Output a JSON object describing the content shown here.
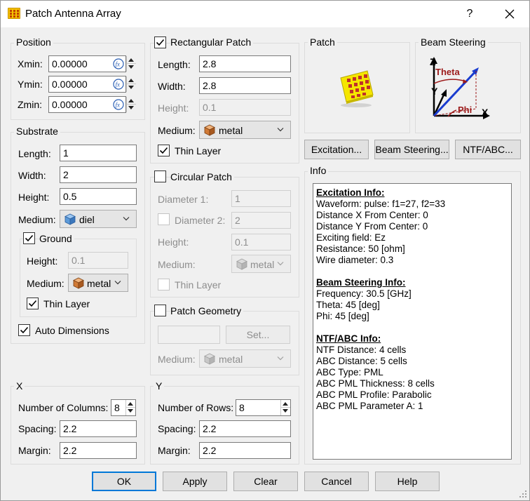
{
  "window": {
    "title": "Patch Antenna Array",
    "help": "?"
  },
  "position": {
    "title": "Position",
    "xmin": {
      "label": "Xmin:",
      "value": "0.00000"
    },
    "ymin": {
      "label": "Ymin:",
      "value": "0.00000"
    },
    "zmin": {
      "label": "Zmin:",
      "value": "0.00000"
    }
  },
  "substrate": {
    "title": "Substrate",
    "length": {
      "label": "Length:",
      "value": "1"
    },
    "width": {
      "label": "Width:",
      "value": "2"
    },
    "height": {
      "label": "Height:",
      "value": "0.5"
    },
    "medium": {
      "label": "Medium:",
      "value": "diel"
    },
    "ground": {
      "label": "Ground",
      "checked": true,
      "height": {
        "label": "Height:",
        "value": "0.1"
      },
      "medium": {
        "label": "Medium:",
        "value": "metal"
      },
      "thin_layer": {
        "label": "Thin Layer",
        "checked": true
      }
    },
    "auto_dimensions": {
      "label": "Auto Dimensions",
      "checked": true
    }
  },
  "rect_patch": {
    "label": "Rectangular Patch",
    "checked": true,
    "length": {
      "label": "Length:",
      "value": "2.8"
    },
    "width": {
      "label": "Width:",
      "value": "2.8"
    },
    "height": {
      "label": "Height:",
      "value": "0.1"
    },
    "medium": {
      "label": "Medium:",
      "value": "metal"
    },
    "thin_layer": {
      "label": "Thin Layer",
      "checked": true
    }
  },
  "circ_patch": {
    "label": "Circular Patch",
    "checked": false,
    "diameter1": {
      "label": "Diameter 1:",
      "value": "1"
    },
    "diameter2": {
      "label": "Diameter 2:",
      "value": "2"
    },
    "height": {
      "label": "Height:",
      "value": "0.1"
    },
    "medium": {
      "label": "Medium:",
      "value": "metal"
    },
    "thin_layer": {
      "label": "Thin Layer"
    }
  },
  "patch_geometry": {
    "label": "Patch Geometry",
    "checked": false,
    "set_label": "Set...",
    "medium": {
      "label": "Medium:",
      "value": "metal"
    }
  },
  "x": {
    "title": "X",
    "count": {
      "label": "Number of Columns:",
      "value": "8"
    },
    "spacing": {
      "label": "Spacing:",
      "value": "2.2"
    },
    "margin": {
      "label": "Margin:",
      "value": "2.2"
    }
  },
  "y": {
    "title": "Y",
    "count": {
      "label": "Number of Rows:",
      "value": "8"
    },
    "spacing": {
      "label": "Spacing:",
      "value": "2.2"
    },
    "margin": {
      "label": "Margin:",
      "value": "2.2"
    }
  },
  "patch_preview": {
    "title": "Patch"
  },
  "beam_preview": {
    "title": "Beam Steering",
    "axis_z": "Z",
    "axis_y": "Y",
    "axis_x": "X",
    "theta": "Theta",
    "phi": "Phi"
  },
  "action_buttons": {
    "excitation": "Excitation...",
    "beam_steering": "Beam Steering...",
    "ntf_abc": "NTF/ABC..."
  },
  "info": {
    "title": "Info",
    "excitation": {
      "heading": "Excitation Info:",
      "lines": [
        "Waveform: pulse: f1=27, f2=33",
        "Distance X From Center: 0",
        "Distance Y From Center: 0",
        "Exciting field: Ez",
        "Resistance: 50 [ohm]",
        "Wire diameter: 0.3"
      ]
    },
    "beam": {
      "heading": "Beam Steering Info:",
      "lines": [
        "Frequency: 30.5 [GHz]",
        "Theta: 45 [deg]",
        "Phi: 45 [deg]"
      ]
    },
    "ntf": {
      "heading": "NTF/ABC Info:",
      "lines": [
        "NTF Distance: 4 cells",
        "ABC Distance: 5 cells",
        "ABC Type: PML",
        "ABC PML Thickness: 8 cells",
        "ABC PML Profile: Parabolic",
        "ABC PML Parameter A: 1"
      ]
    }
  },
  "footer": {
    "ok": "OK",
    "apply": "Apply",
    "clear": "Clear",
    "cancel": "Cancel",
    "help": "Help"
  },
  "colors": {
    "accent": "#0078d7",
    "patch_yellow": "#f5e600",
    "patch_red": "#c0302a",
    "beam_blue": "#1a3ccf",
    "theta_red": "#9c1a1a"
  }
}
